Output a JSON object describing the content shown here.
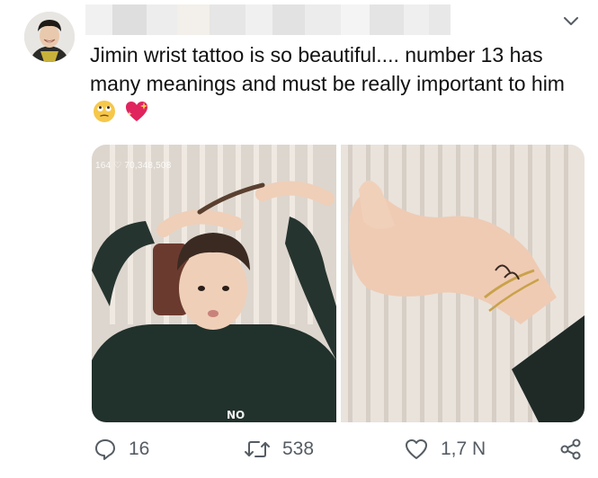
{
  "tweet": {
    "text": "Jimin wrist tattoo is so beautiful.... number 13 has many meanings and must be really important to him",
    "emojis": [
      "face-with-rolling-eyes-emoji",
      "sparkling-heart-emoji"
    ],
    "photo_overlay": "164 ♡ 70,348,508"
  },
  "actions": {
    "replies": "16",
    "retweets": "538",
    "likes": "1,7 N"
  },
  "icons": {
    "more": "chevron-down-icon",
    "reply": "reply-icon",
    "retweet": "retweet-icon",
    "like": "heart-icon",
    "share": "share-icon"
  },
  "colors": {
    "text": "#111111",
    "icon": "#555c63",
    "background": "#ffffff"
  }
}
